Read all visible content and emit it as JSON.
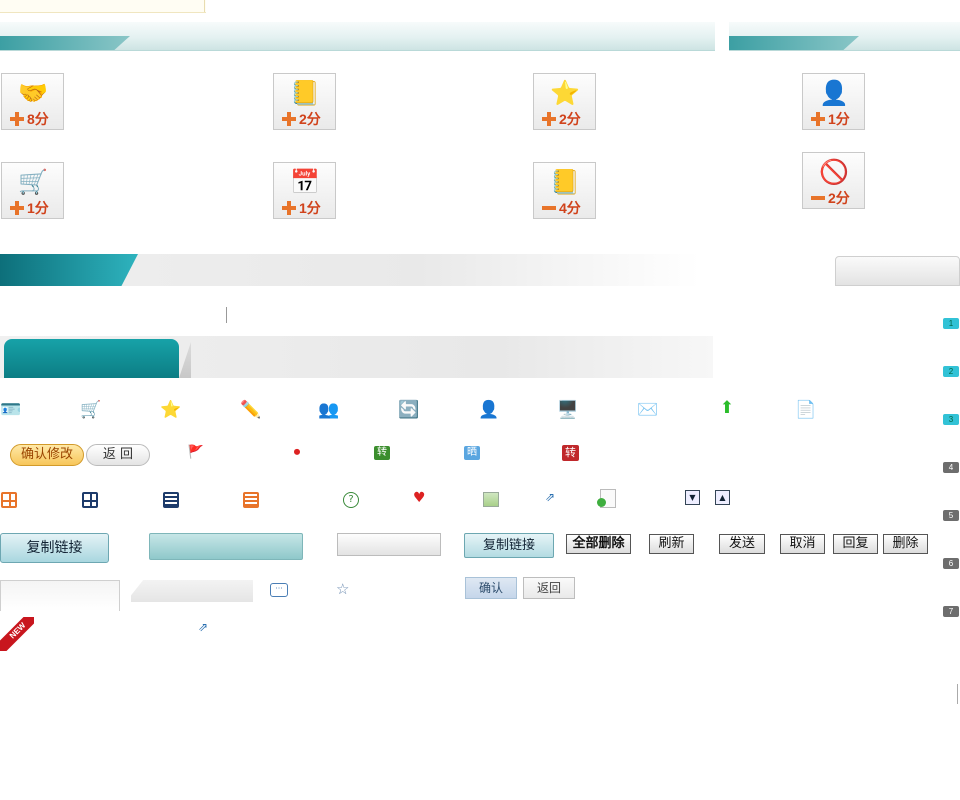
{
  "tiles": [
    {
      "icon": "🤝",
      "sign": "plus",
      "points": "8分"
    },
    {
      "icon": "📒",
      "sign": "plus",
      "points": "2分"
    },
    {
      "icon": "⭐",
      "sign": "plus",
      "points": "2分"
    },
    {
      "icon": "👤",
      "sign": "plus",
      "points": "1分"
    },
    {
      "icon": "🛒",
      "sign": "plus",
      "points": "1分"
    },
    {
      "icon": "📅",
      "sign": "plus",
      "points": "1分"
    },
    {
      "icon": "📒",
      "sign": "minus",
      "points": "4分"
    },
    {
      "icon": "🚫",
      "sign": "minus",
      "points": "2分"
    }
  ],
  "page_numbers": [
    "1",
    "2",
    "3",
    "4",
    "5",
    "6",
    "7"
  ],
  "icon_row1": [
    "🪪",
    "🛒",
    "⭐",
    "✏️",
    "👥",
    "🔄",
    "👤",
    "🖥️",
    "✉️",
    "⬆",
    "📄"
  ],
  "icon_row2": [
    "🚩",
    "⏺",
    "转",
    "晒",
    "转"
  ],
  "buttons": {
    "confirm_edit": "确认修改",
    "back": "返 回",
    "copy_link_large": "复制链接",
    "copy_link_small": "复制链接",
    "delete_all": "全部删除",
    "refresh": "刷新",
    "send": "发送",
    "cancel": "取消",
    "reply": "回复",
    "delete": "删除",
    "confirm": "确认",
    "back_small": "返回"
  },
  "ribbon": "NEW"
}
